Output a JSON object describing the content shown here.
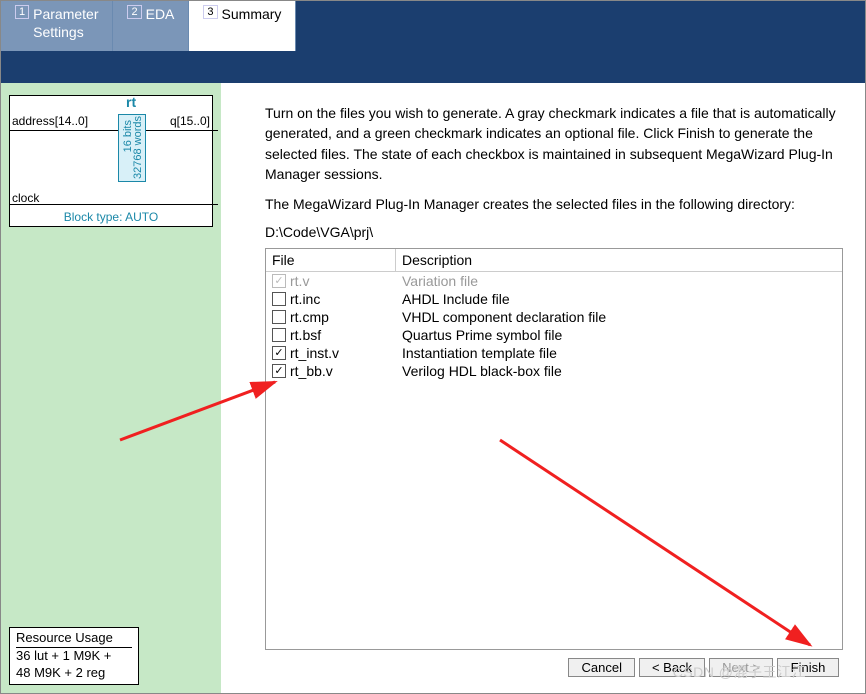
{
  "tabs": [
    {
      "num": "1",
      "label": "Parameter\nSettings"
    },
    {
      "num": "2",
      "label": "EDA"
    },
    {
      "num": "3",
      "label": "Summary"
    }
  ],
  "active_tab": 2,
  "diagram": {
    "title": "rt",
    "addr": "address[14..0]",
    "q": "q[15..0]",
    "clock": "clock",
    "bits": "16 bits",
    "words": "32768 words",
    "block_type": "Block type: AUTO"
  },
  "resource": {
    "title": "Resource Usage",
    "line1": "36 lut + 1 M9K +",
    "line2": "48 M9K + 2 reg"
  },
  "instructions": {
    "p1": "Turn on the files you wish to generate. A gray checkmark indicates a file that is automatically generated, and a green checkmark indicates an optional file. Click Finish to generate the selected files. The state of each checkbox is maintained in subsequent MegaWizard Plug-In Manager sessions.",
    "p2": "The MegaWizard Plug-In Manager creates the selected files in the following directory:",
    "dir": "D:\\Code\\VGA\\prj\\"
  },
  "table": {
    "h_file": "File",
    "h_desc": "Description",
    "rows": [
      {
        "checked": "auto",
        "file": "rt.v",
        "desc": "Variation file"
      },
      {
        "checked": "off",
        "file": "rt.inc",
        "desc": "AHDL Include file"
      },
      {
        "checked": "off",
        "file": "rt.cmp",
        "desc": "VHDL component declaration file"
      },
      {
        "checked": "off",
        "file": "rt.bsf",
        "desc": "Quartus Prime symbol file"
      },
      {
        "checked": "on",
        "file": "rt_inst.v",
        "desc": "Instantiation template file"
      },
      {
        "checked": "on",
        "file": "rt_bb.v",
        "desc": "Verilog HDL black-box file"
      }
    ]
  },
  "buttons": {
    "cancel": "Cancel",
    "back": "< Back",
    "next": "Next >",
    "finish": "Finish"
  },
  "watermark": "CSDN @混子王江江"
}
